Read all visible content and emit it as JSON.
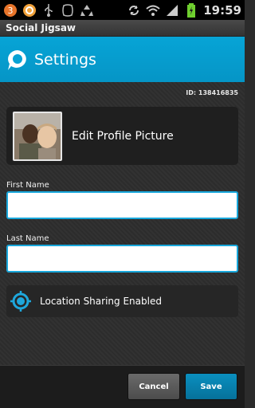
{
  "status_bar": {
    "time": "19:59",
    "notification_count": "3",
    "left_icons": [
      "notification-badge-icon",
      "app-notification-icon",
      "usb-icon",
      "app-outline-icon",
      "recycle-icon"
    ],
    "right_icons": [
      "sync-icon",
      "wifi-icon",
      "signal-icon",
      "battery-charging-icon"
    ]
  },
  "app": {
    "name": "Social Jigsaw"
  },
  "header": {
    "title": "Settings",
    "logo_icon": "speech-bubble-logo-icon",
    "color": "#08a2d4"
  },
  "profile": {
    "user_id": "ID: 138416835",
    "edit_label": "Edit Profile Picture"
  },
  "form": {
    "first_name_label": "First Name",
    "first_name_value": "",
    "last_name_label": "Last Name",
    "last_name_value": ""
  },
  "location": {
    "label": "Location Sharing Enabled",
    "icon": "location-target-icon"
  },
  "actions": {
    "cancel_label": "Cancel",
    "save_label": "Save",
    "save_color": "#0a86b5"
  }
}
